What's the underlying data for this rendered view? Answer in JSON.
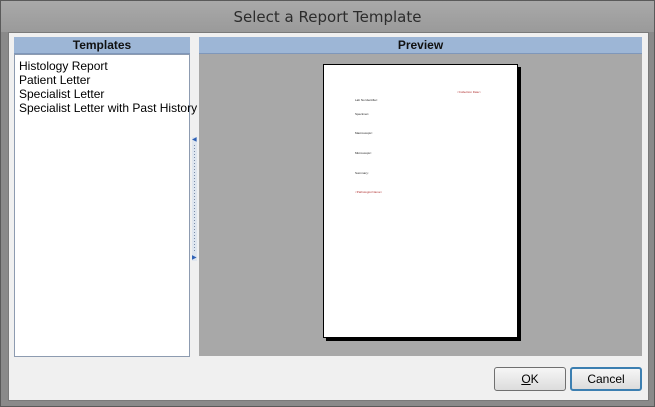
{
  "window": {
    "title": "Select a Report Template"
  },
  "templates": {
    "header": "Templates",
    "items": [
      "Histology Report",
      "Patient Letter",
      "Specialist Letter",
      "Specialist Letter with Past History"
    ]
  },
  "preview": {
    "header": "Preview",
    "page_lines": {
      "collection_date": "<Collection Date>",
      "lab_identifier": "Lab No Identifier:",
      "specimen": "Specimen:",
      "macroscopic": "Macroscopic:",
      "microscopic": "Microscopic:",
      "summary": "Summary:",
      "pathologist": "<Pathologist Name>"
    }
  },
  "buttons": {
    "ok_label": "OK",
    "ok_mnemonic": "O",
    "ok_rest": "K",
    "cancel_label": "Cancel"
  },
  "colors": {
    "header_bg": "#9db6d6",
    "preview_bg": "#a8a8a8",
    "focus_border": "#3c7fb1"
  }
}
